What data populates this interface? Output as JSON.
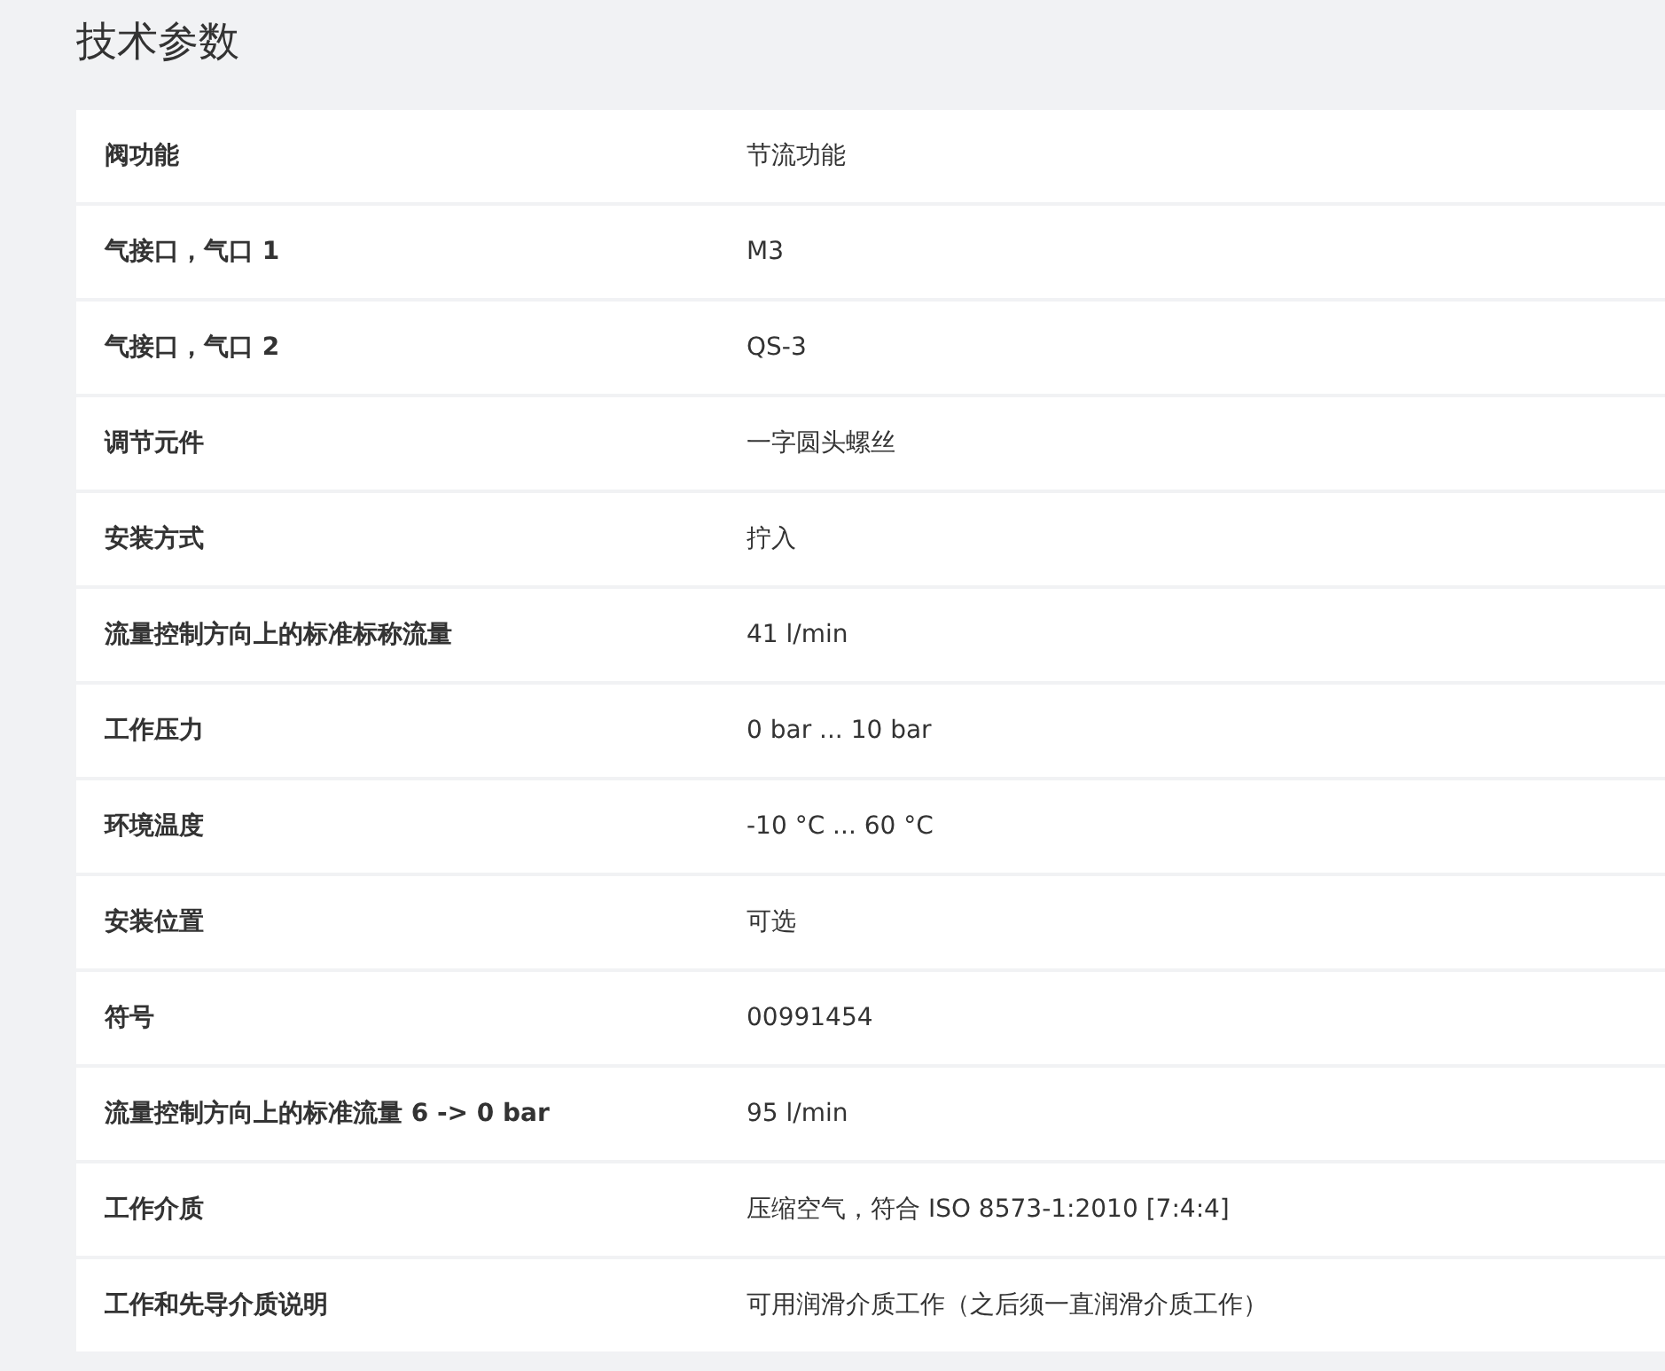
{
  "title": "技术参数",
  "rows": [
    {
      "label": "阀功能",
      "value": "节流功能"
    },
    {
      "label": "气接口，气口 1",
      "value": "M3"
    },
    {
      "label": "气接口，气口 2",
      "value": "QS-3"
    },
    {
      "label": "调节元件",
      "value": "一字圆头螺丝"
    },
    {
      "label": "安装方式",
      "value": "拧入"
    },
    {
      "label": "流量控制方向上的标准标称流量",
      "value": "41 l/min"
    },
    {
      "label": "工作压力",
      "value": "0 bar ... 10 bar"
    },
    {
      "label": "环境温度",
      "value": "-10 °C ... 60 °C"
    },
    {
      "label": "安装位置",
      "value": "可选"
    },
    {
      "label": "符号",
      "value": "00991454"
    },
    {
      "label": "流量控制方向上的标准流量 6 -> 0 bar",
      "value": "95 l/min"
    },
    {
      "label": "工作介质",
      "value": "压缩空气，符合 ISO 8573-1:2010 [7:4:4]"
    },
    {
      "label": "工作和先导介质说明",
      "value": "可用润滑介质工作（之后须一直润滑介质工作）"
    }
  ]
}
